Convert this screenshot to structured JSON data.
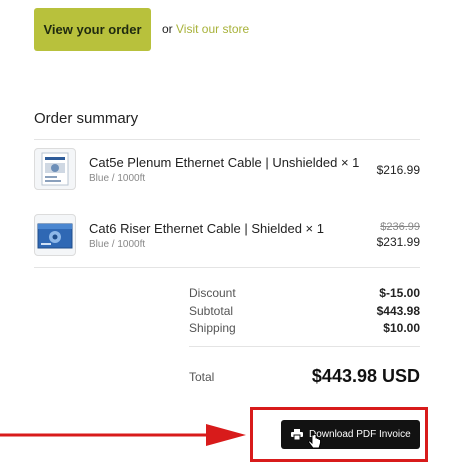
{
  "actions": {
    "view_order_label": "View your order",
    "or_text": "or",
    "visit_store_label": "Visit our store"
  },
  "summary": {
    "title": "Order summary",
    "items": [
      {
        "title": "Cat5e Plenum Ethernet Cable | Unshielded × 1",
        "variant": "Blue / 1000ft",
        "price": "$216.99",
        "image_icon": "cable-box-white-icon"
      },
      {
        "title": "Cat6 Riser Ethernet Cable | Shielded × 1",
        "variant": "Blue / 1000ft",
        "original_price": "$236.99",
        "price": "$231.99",
        "image_icon": "cable-box-blue-icon"
      }
    ],
    "totals": {
      "discount_label": "Discount",
      "discount_value": "$-15.00",
      "subtotal_label": "Subtotal",
      "subtotal_value": "$443.98",
      "shipping_label": "Shipping",
      "shipping_value": "$10.00",
      "total_label": "Total",
      "total_value": "$443.98 USD"
    }
  },
  "invoice": {
    "download_label": "Download PDF Invoice",
    "icon": "printer-icon"
  },
  "colors": {
    "accent": "#b8c13c",
    "highlight": "#d81b1b",
    "button_dark": "#121212"
  }
}
